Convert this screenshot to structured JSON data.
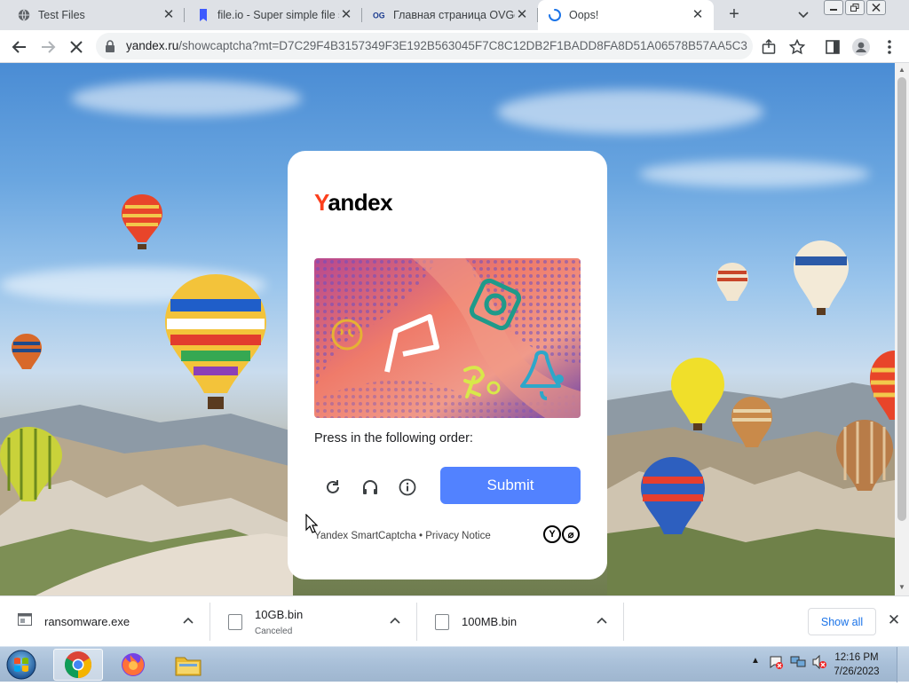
{
  "tabs": [
    {
      "title": "Test Files",
      "icon": "globe-icon"
    },
    {
      "title": "file.io - Super simple file s",
      "icon": "fileio-icon"
    },
    {
      "title": "Главная страница OVGo",
      "icon": "ovgorskiy-icon"
    },
    {
      "title": "Oops!",
      "icon": "loading-spinner-icon"
    }
  ],
  "address_bar": {
    "host": "yandex.ru",
    "path": "/showcaptcha?mt=D7C29F4B3157349F3E192B563045F7C8C12DB2F1BADD8FA8D51A06578B57AA5C3..."
  },
  "captcha": {
    "logo_first_letter": "Y",
    "logo_rest": "andex",
    "instruction": "Press in the following order:",
    "submit_label": "Submit",
    "footer": "Yandex SmartCaptcha • Privacy Notice",
    "accent_color": "#5282ff"
  },
  "downloads": [
    {
      "name": "ransomware.exe",
      "status": ""
    },
    {
      "name": "10GB.bin",
      "status": "Canceled"
    },
    {
      "name": "100MB.bin",
      "status": ""
    }
  ],
  "download_bar": {
    "show_all_label": "Show all"
  },
  "taskbar": {
    "time": "12:16 PM",
    "date": "7/26/2023",
    "apps": [
      "chrome-icon",
      "firefox-icon",
      "file-explorer-icon"
    ]
  }
}
